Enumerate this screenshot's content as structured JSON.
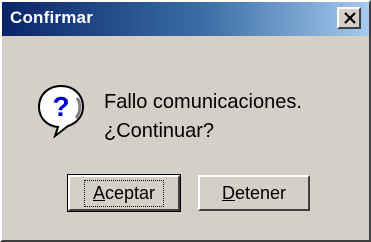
{
  "window": {
    "title": "Confirmar"
  },
  "dialog": {
    "icon": "question-icon",
    "message_line1": "Fallo comunicaciones.",
    "message_line2": "¿Continuar?"
  },
  "buttons": {
    "accept": {
      "mnemonic": "A",
      "rest": "ceptar",
      "default": true
    },
    "stop": {
      "mnemonic": "D",
      "rest": "etener",
      "default": false
    }
  },
  "colors": {
    "titlebar_start": "#0a246a",
    "titlebar_end": "#a6caf0",
    "face": "#d4d0c8"
  }
}
